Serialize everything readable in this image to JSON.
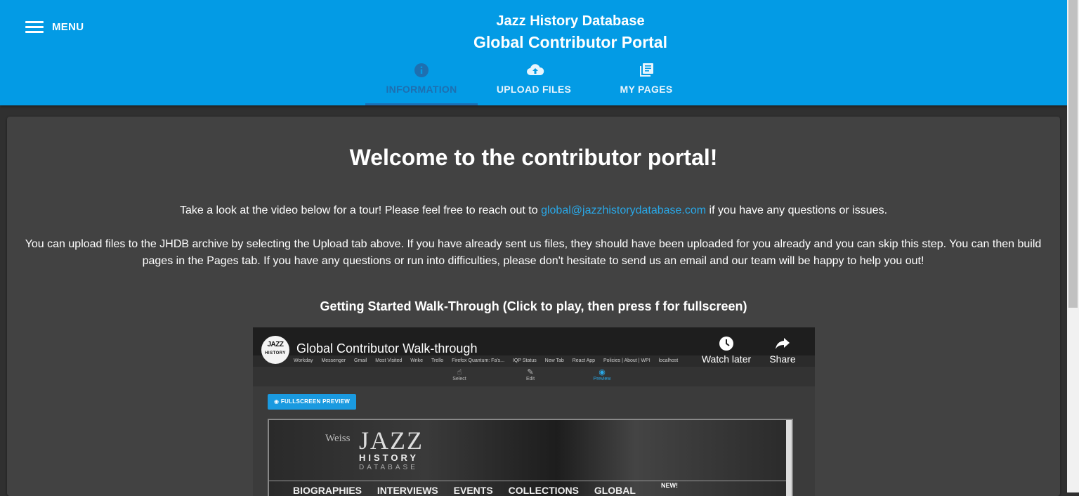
{
  "header": {
    "menu_label": "MENU",
    "title": "Jazz History Database",
    "subtitle": "Global Contributor Portal",
    "tabs": [
      {
        "label": "INFORMATION",
        "icon": "info-icon",
        "active": true
      },
      {
        "label": "UPLOAD FILES",
        "icon": "cloud-upload-icon",
        "active": false
      },
      {
        "label": "MY PAGES",
        "icon": "library-books-icon",
        "active": false
      }
    ]
  },
  "main": {
    "heading": "Welcome to the contributor portal!",
    "intro_before": "Take a look at the video below for a tour! Please feel free to reach out to ",
    "email": "global@jazzhistorydatabase.com",
    "intro_after": " if you have any questions or issues.",
    "upload_text": "You can upload files to the JHDB archive by selecting the Upload tab above. If you have already sent us files, they should have been uploaded for you already and you can skip this step. You can then build pages in the Pages tab. If you have any questions or run into difficulties, please don't hesitate to send us an email and our team will be happy to help you out!",
    "video_caption": "Getting Started Walk-Through (Click to play, then press f for fullscreen)"
  },
  "video": {
    "title": "Global Contributor Walk-through",
    "watch_later": "Watch later",
    "share": "Share",
    "bookmarks": [
      "Workday",
      "Messenger",
      "Gmail",
      "Most Visited",
      "Wrike",
      "Trello",
      "Firefox Quantum: Fa's...",
      "IQP Status",
      "New Tab",
      "React App",
      "Policies | About | WPI",
      "localhost"
    ],
    "tools": [
      "Select",
      "Edit",
      "Preview"
    ],
    "fullscreen_label": "FULLSCREEN PREVIEW",
    "preview": {
      "weiss": "Weiss",
      "jazz": "JAZZ",
      "history": "HISTORY",
      "database": "DATABASE",
      "nav": [
        "BIOGRAPHIES",
        "INTERVIEWS",
        "EVENTS",
        "COLLECTIONS",
        "GLOBAL"
      ],
      "new_badge": "NEW!"
    }
  },
  "colors": {
    "appbar": "#039be5",
    "active_tab": "#1e6fb0",
    "link": "#29a8e8",
    "card": "#424242",
    "background": "#303030"
  }
}
